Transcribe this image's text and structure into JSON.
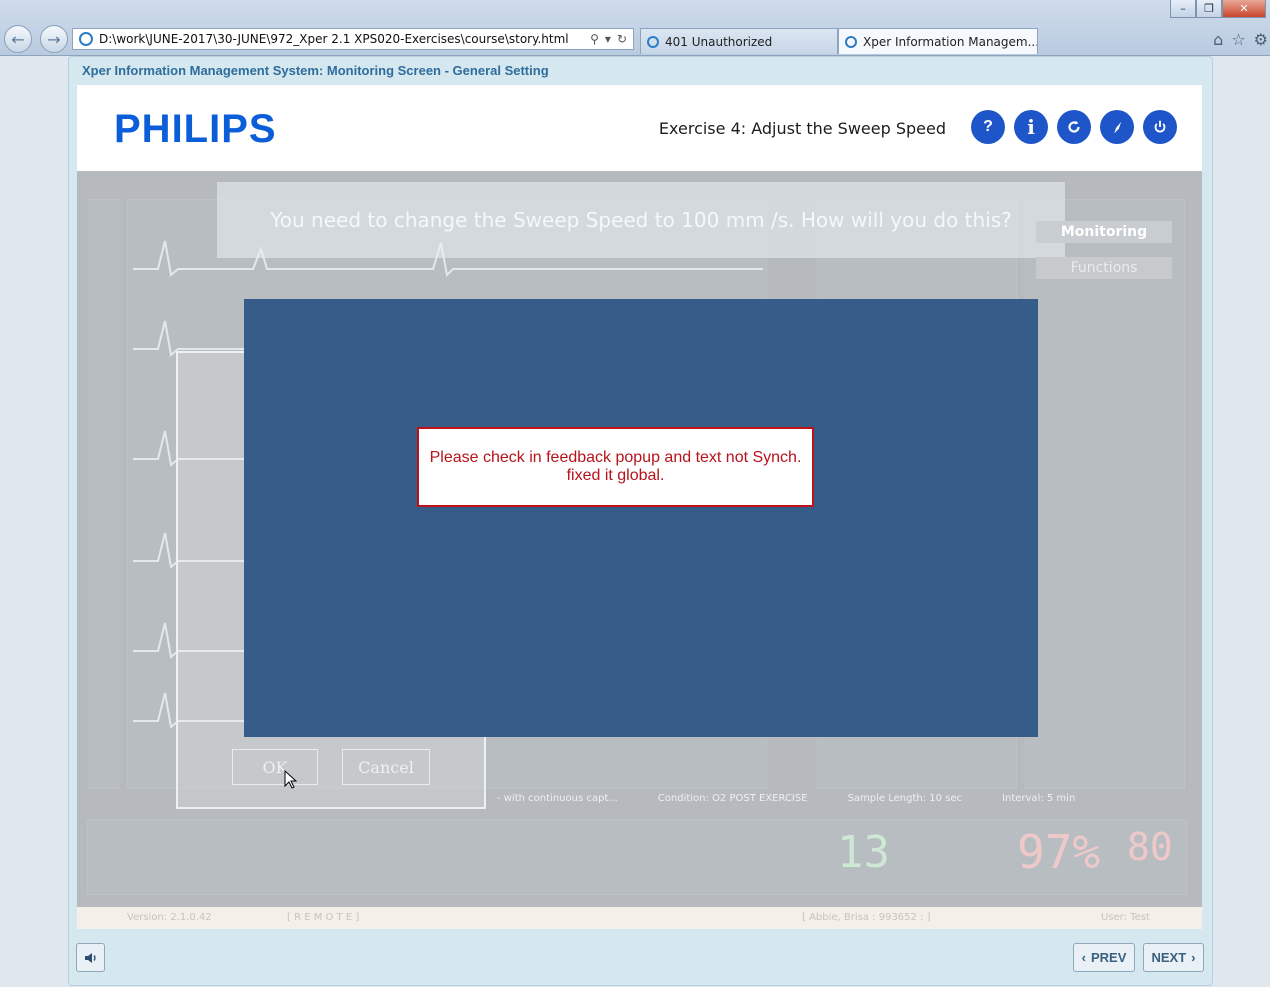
{
  "browser": {
    "address": "D:\\work\\JUNE-2017\\30-JUNE\\972_Xper 2.1 XPS020-Exercises\\course\\story.html",
    "tabs": [
      {
        "label": "401 Unauthorized",
        "active": false
      },
      {
        "label": "Xper Information Managem...",
        "active": true
      }
    ],
    "window_controls": [
      "minimize",
      "restore",
      "close"
    ]
  },
  "course": {
    "frame_title": "Xper Information Management System: Monitoring Screen - General Setting",
    "logo": "PHILIPS",
    "exercise_title": "Exercise 4: Adjust the Sweep Speed",
    "header_buttons": [
      {
        "icon": "help-icon",
        "glyph": "?"
      },
      {
        "icon": "info-icon",
        "glyph": "i"
      },
      {
        "icon": "restart-icon",
        "glyph": ""
      },
      {
        "icon": "compass-icon",
        "glyph": ""
      },
      {
        "icon": "power-icon",
        "glyph": ""
      }
    ],
    "question": "You need to change the Sweep Speed to 100 mm /s. How will you do this?",
    "side_labels": [
      "Monitoring",
      "Functions"
    ],
    "dialog": {
      "ok": "OK",
      "cancel": "Cancel"
    },
    "status_strip": [
      "- with continuous capt...",
      "Condition: O2 POST EXERCISE",
      "Sample Length: 10 sec",
      "Interval: 5 min"
    ],
    "vitals": {
      "rate": "13",
      "spo2": "97%",
      "pr": "80"
    },
    "footer": {
      "version": "Version: 2.1.0.42",
      "mode": "[ R E M O T E ]",
      "patient": "[ Abbie, Brisa  : 993652 : ]",
      "user": "User: Test"
    },
    "notice": "Please check in feedback popup and text not Synch. fixed it global.",
    "nav": {
      "prev": "PREV",
      "next": "NEXT"
    }
  },
  "colors": {
    "accent": "#1e55c8",
    "overlay": "#365d8a",
    "notice_border": "#c0111b",
    "notice_text": "#b8121b"
  }
}
